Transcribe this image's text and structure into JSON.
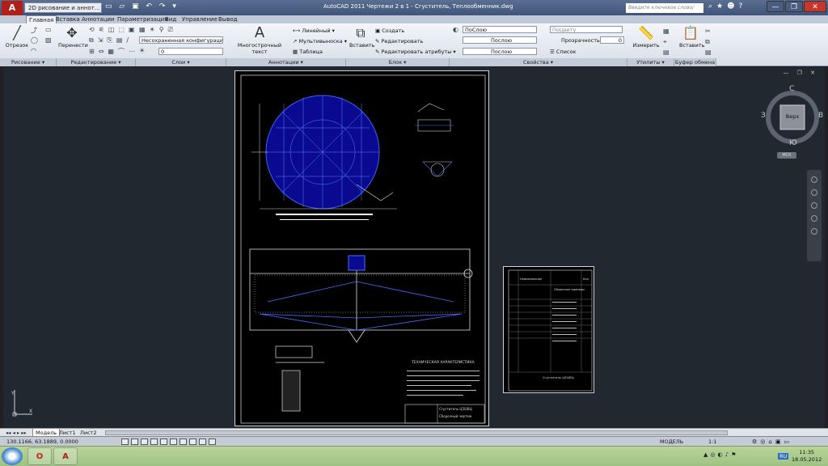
{
  "app": {
    "logo": "A",
    "workspace": "2D рисование и аннот...",
    "title": "AutoCAD 2011     Чертежи 2 в 1 - Сгуститель, Теплообменник.dwg",
    "search_placeholder": "Введите ключевое слово/фразу",
    "minimize": "—",
    "restore": "❐",
    "close": "✕"
  },
  "tabs": [
    "Главная",
    "Вставка",
    "Аннотации",
    "Параметризация",
    "Вид",
    "Управление",
    "Вывод"
  ],
  "ribbon": {
    "draw": {
      "line": "Отрезок",
      "footer": "Рисование ▾"
    },
    "modify": {
      "move": "Перенести",
      "footer": "Редактирование ▾"
    },
    "layers": {
      "config": "Несохраненная конфигурация сл",
      "layer_value": "0",
      "footer": "Слои ▾"
    },
    "annotations": {
      "mtext": "Многострочный текст",
      "linear": "Линейный",
      "mleader": "Мультивыноска",
      "table": "Таблица",
      "footer": "Аннотации ▾"
    },
    "block": {
      "insert": "Вставить",
      "create": "Создать",
      "edit": "Редактировать",
      "edit_attr": "Редактировать атрибуты",
      "footer": "Блок ▾"
    },
    "properties": {
      "color": "ПоСлою",
      "linetype": "Послою",
      "lineweight": "Послою",
      "plotstyle": "ПоЦвету",
      "transparency_label": "Прозрачность",
      "transparency_value": "0",
      "list": "Список",
      "footer": "Свойства ▾"
    },
    "utilities": {
      "measure": "Измерить",
      "footer": "Утилиты ▾"
    },
    "clipboard": {
      "paste": "Вставить",
      "footer": "Буфер обмена"
    }
  },
  "viewcube": {
    "north": "С",
    "south": "Ю",
    "west": "З",
    "east": "В",
    "top": "Верх",
    "wcs": "МСК"
  },
  "drawing": {
    "spec_title": "ТЕХНИЧЕСКАЯ ХАРАКТЕРИСТИКА",
    "stamp_title": "Сгуститель  Ц50/ВЦ",
    "stamp_sub": "Сборочный чертеж",
    "spec2_header1": "Наименование",
    "spec2_header2": "Кол.",
    "spec2_section": "Сборочные единицы",
    "spec2_stamp": "Сгуститель  Ц50/ВЦ"
  },
  "layouts": [
    "Модель",
    "Лист1",
    "Лист2"
  ],
  "status": {
    "coords": "130.1166, 63.1889, 0.0000",
    "model": "МОДЕЛЬ",
    "scale": "1:1"
  },
  "taskbar": {
    "time": "11:35",
    "date": "18.05.2012",
    "lang": "RU"
  }
}
